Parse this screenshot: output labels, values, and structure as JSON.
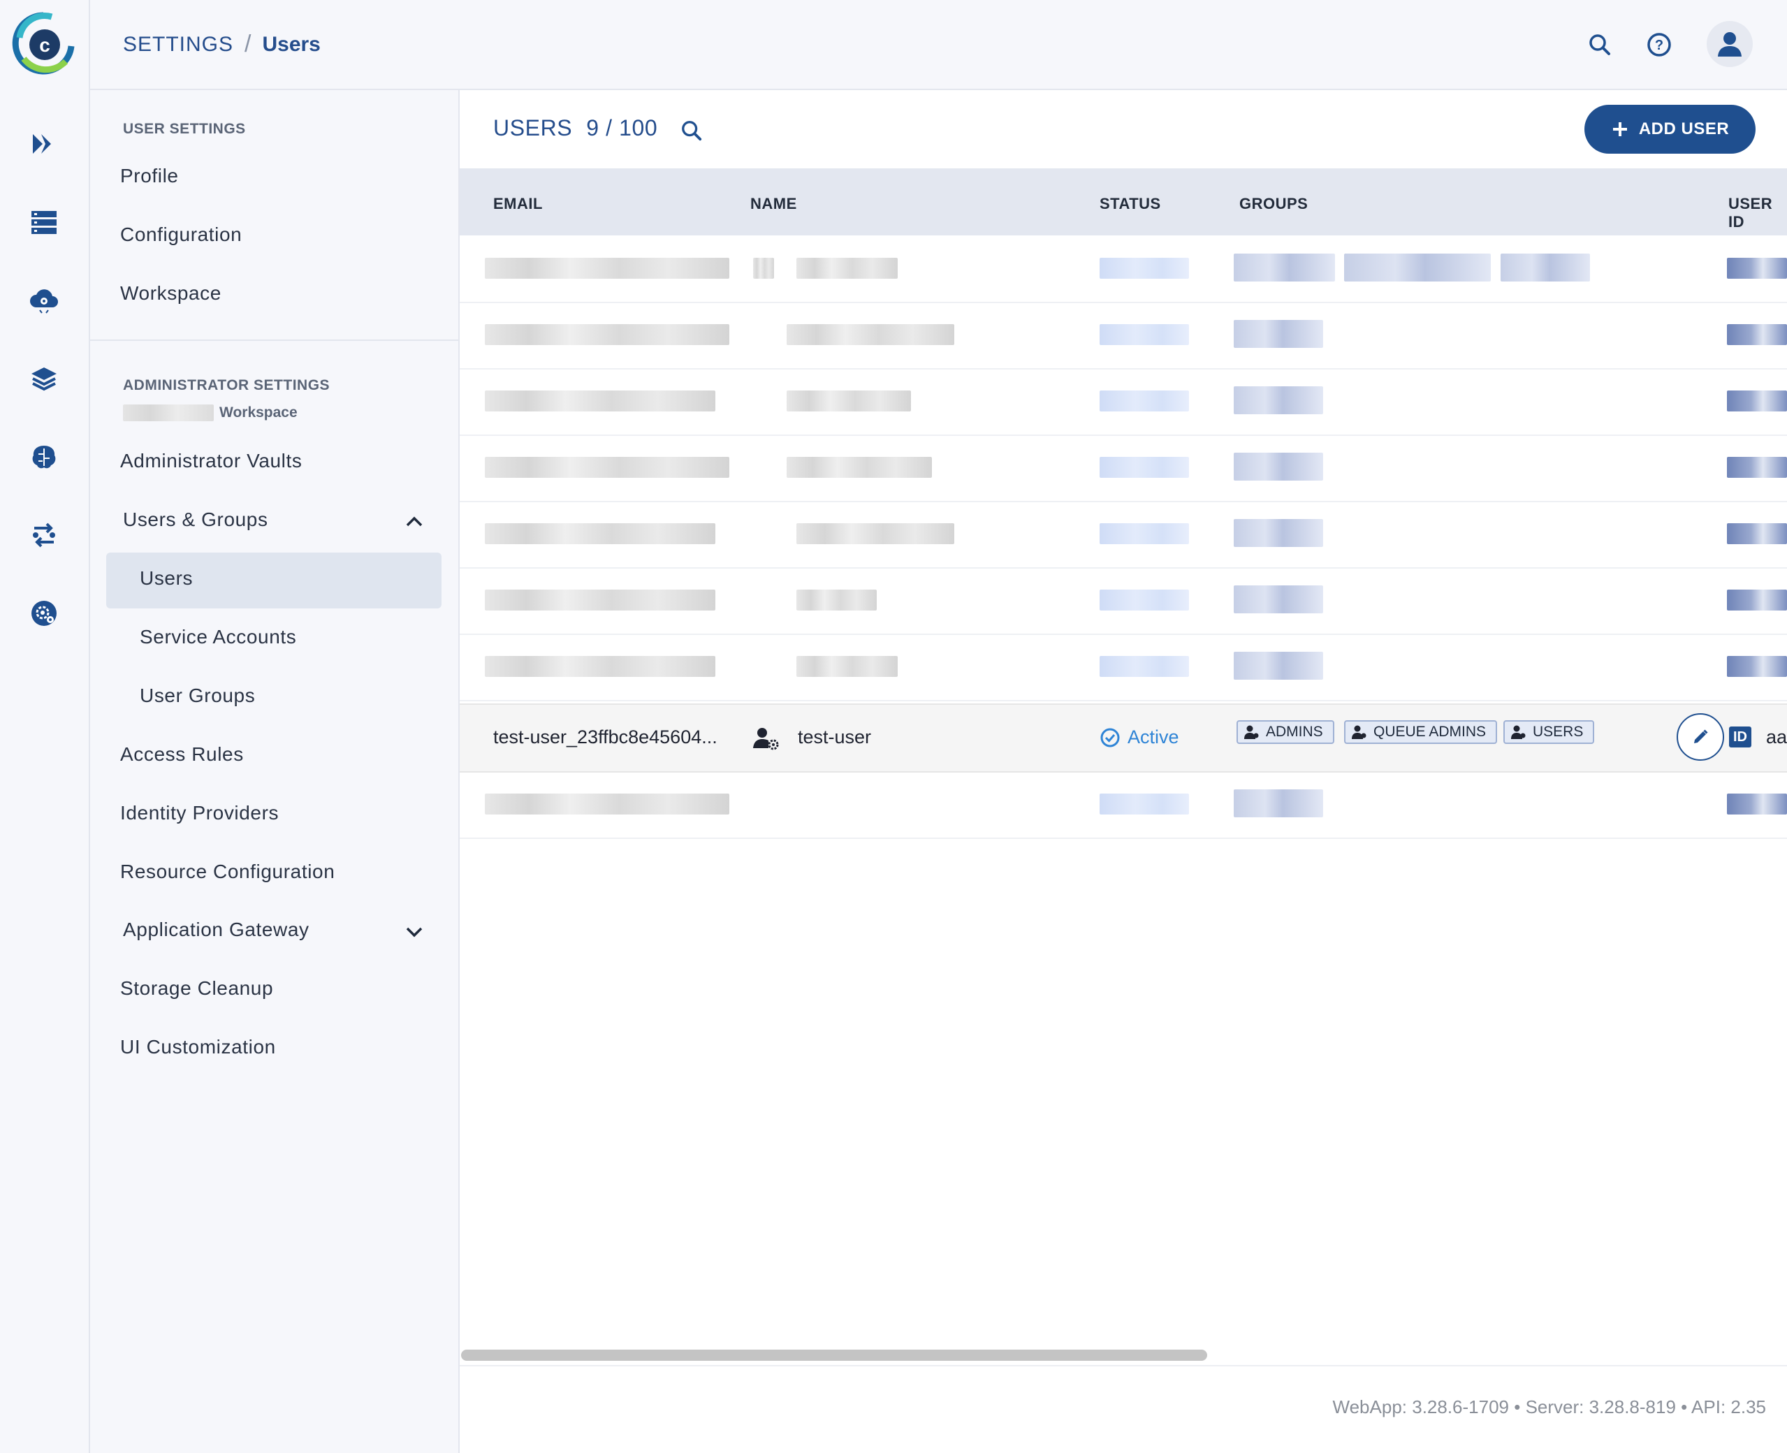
{
  "breadcrumb": {
    "root": "SETTINGS",
    "separator": "/",
    "current": "Users"
  },
  "rail": {
    "items": [
      "pipelines-icon",
      "datasets-icon",
      "cloud-gear-icon",
      "layers-icon",
      "brain-icon",
      "orchestration-icon",
      "settings-gear-icon"
    ]
  },
  "sidebar": {
    "user_settings_title": "USER SETTINGS",
    "user_items": [
      "Profile",
      "Configuration",
      "Workspace"
    ],
    "admin_settings_title": "ADMINISTRATOR SETTINGS",
    "admin_workspace_suffix": "Workspace",
    "admin_items": {
      "vaults": "Administrator Vaults",
      "users_groups": "Users & Groups",
      "users": "Users",
      "service_accounts": "Service Accounts",
      "user_groups": "User Groups",
      "access_rules": "Access Rules",
      "identity_providers": "Identity Providers",
      "resource_configuration": "Resource Configuration",
      "application_gateway": "Application Gateway",
      "storage_cleanup": "Storage Cleanup",
      "ui_customization": "UI Customization"
    }
  },
  "main": {
    "title": "USERS",
    "count": "9 / 100",
    "add_button": "ADD USER",
    "columns": {
      "email": "EMAIL",
      "name": "NAME",
      "status": "STATUS",
      "groups": "GROUPS",
      "user_id": "USER ID"
    },
    "visible_user": {
      "email": "test-user_23ffbc8e45604...",
      "name": "test-user",
      "status": "Active",
      "groups": [
        "ADMINS",
        "QUEUE ADMINS",
        "USERS"
      ],
      "id_badge": "ID",
      "id_prefix": "aa"
    }
  },
  "footer": {
    "versions": "WebApp: 3.28.6-1709 • Server: 3.28.8-819 • API: 2.35"
  },
  "colors": {
    "accent": "#1f4f8f",
    "status_active": "#2e84d6",
    "header_bg": "#e3e7f0",
    "selected_nav": "#dfe5ef"
  }
}
